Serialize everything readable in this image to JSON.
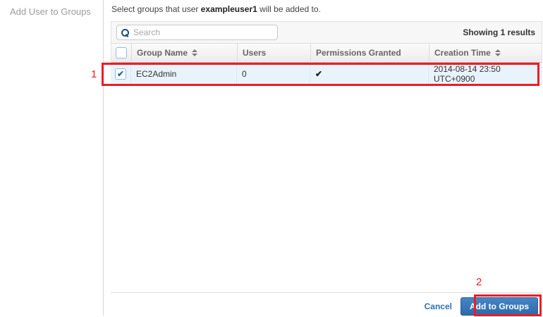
{
  "sidebar": {
    "title": "Add User to Groups"
  },
  "main": {
    "description": {
      "prefix": "Select groups that user ",
      "username": "exampleuser1",
      "suffix": " will be added to."
    },
    "toolbar": {
      "search_placeholder": "Search",
      "results_text": "Showing 1 results"
    },
    "table": {
      "columns": {
        "group_name": "Group Name",
        "users": "Users",
        "permissions": "Permissions Granted",
        "creation_time": "Creation Time"
      },
      "row": {
        "selected": true,
        "group_name": "EC2Admin",
        "users": "0",
        "permissions_granted": true,
        "creation_time": "2014-08-14 23:50 UTC+0900"
      }
    },
    "footer": {
      "cancel_label": "Cancel",
      "submit_label": "Add to Groups"
    }
  },
  "icons": {
    "check": "✔"
  },
  "annotations": {
    "step1": "1",
    "step2": "2",
    "highlight_color": "#ed1c24"
  },
  "colors": {
    "accent_blue": "#2e6aa8",
    "selected_row_bg": "#e9f3fb"
  }
}
